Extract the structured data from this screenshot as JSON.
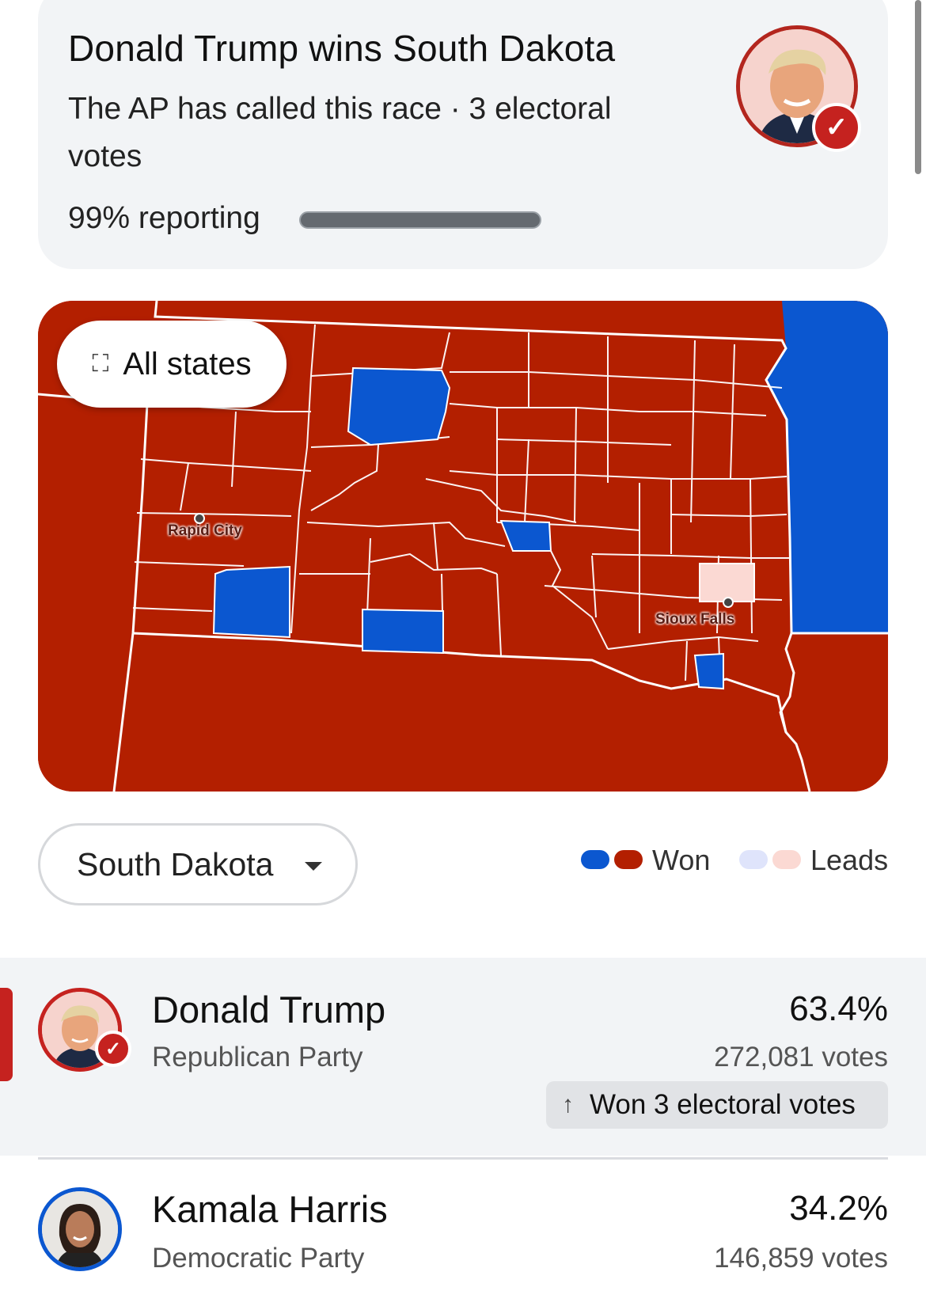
{
  "header": {
    "title": "Donald Trump wins South Dakota",
    "subtitle": "The AP has called this race · 3 electoral votes",
    "reporting_label": "99% reporting",
    "reporting_fraction": 0.99
  },
  "map": {
    "all_states_label": "All states",
    "cities": [
      "Rapid City",
      "Sioux Falls"
    ],
    "colors": {
      "won_rep": "#b31f00",
      "won_dem": "#0b57d0",
      "leads_rep": "#fbd9d3",
      "leads_dem": "#dfe4fb"
    }
  },
  "state_select": {
    "value": "South Dakota"
  },
  "legend": {
    "won_label": "Won",
    "leads_label": "Leads"
  },
  "candidates": [
    {
      "name": "Donald Trump",
      "party": "Republican Party",
      "percent": "63.4%",
      "votes": "272,081 votes",
      "won_label": "Won 3 electoral votes",
      "color": "#c5221f"
    },
    {
      "name": "Kamala Harris",
      "party": "Democratic Party",
      "percent": "34.2%",
      "votes": "146,859 votes",
      "color": "#0b57d0"
    }
  ]
}
